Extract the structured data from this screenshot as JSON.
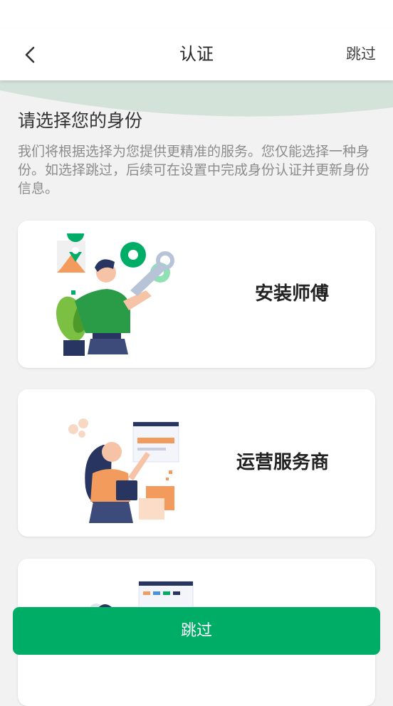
{
  "header": {
    "title": "认证",
    "skip_label": "跳过",
    "back_icon": "chevron-left-icon"
  },
  "intro": {
    "heading": "请选择您的身份",
    "description": "我们将根据选择为您提供更精准的服务。您仅能选择一种身份。如选择跳过，后续可在设置中完成身份认证并更新身份信息。"
  },
  "roles": [
    {
      "label": "安装师傅",
      "icon": "installer-illustration"
    },
    {
      "label": "运营服务商",
      "icon": "operator-illustration"
    },
    {
      "label": "",
      "icon": "developer-illustration"
    }
  ],
  "footer": {
    "skip_button": "跳过"
  },
  "colors": {
    "primary": "#00ad67",
    "wave": "#d3e3da",
    "background": "#f2f2f2"
  }
}
